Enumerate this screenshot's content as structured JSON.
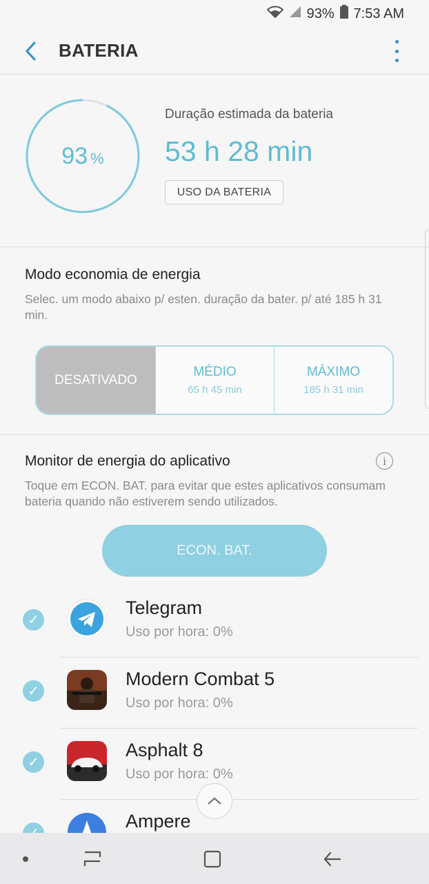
{
  "status_bar": {
    "battery": "93%",
    "time": "7:53 AM"
  },
  "app_bar": {
    "title": "BATERIA"
  },
  "battery": {
    "level_percent": 93,
    "level_text": "93",
    "percent_sign": "%",
    "estimate_label": "Duração estimada da bateria",
    "estimate_value": "53 h 28 min",
    "usage_button": "USO DA BATERIA"
  },
  "power_saving": {
    "title": "Modo economia de energia",
    "description": "Selec. um modo abaixo p/ esten. duração da bater. p/ até 185 h 31 min.",
    "modes": [
      {
        "label": "DESATIVADO",
        "sub": ""
      },
      {
        "label": "MÉDIO",
        "sub": "65 h 45 min"
      },
      {
        "label": "MÁXIMO",
        "sub": "185 h 31 min"
      }
    ],
    "selected_mode": "DESATIVADO"
  },
  "monitor": {
    "title": "Monitor de energia do aplicativo",
    "description": "Toque em ECON. BAT. para evitar que estes aplicativos consumam bateria quando não estiverem sendo utilizados.",
    "button": "ECON. BAT.",
    "apps": [
      {
        "name": "Telegram",
        "usage": "Uso por hora: 0%",
        "checked": true
      },
      {
        "name": "Modern Combat 5",
        "usage": "Uso por hora: 0%",
        "checked": true
      },
      {
        "name": "Asphalt 8",
        "usage": "Uso por hora: 0%",
        "checked": true
      },
      {
        "name": "Ampere",
        "usage": "",
        "checked": true
      }
    ]
  },
  "colors": {
    "accent": "#5fbcd3",
    "accent_light": "#8fd0e2",
    "link_blue": "#2f8fd0"
  }
}
